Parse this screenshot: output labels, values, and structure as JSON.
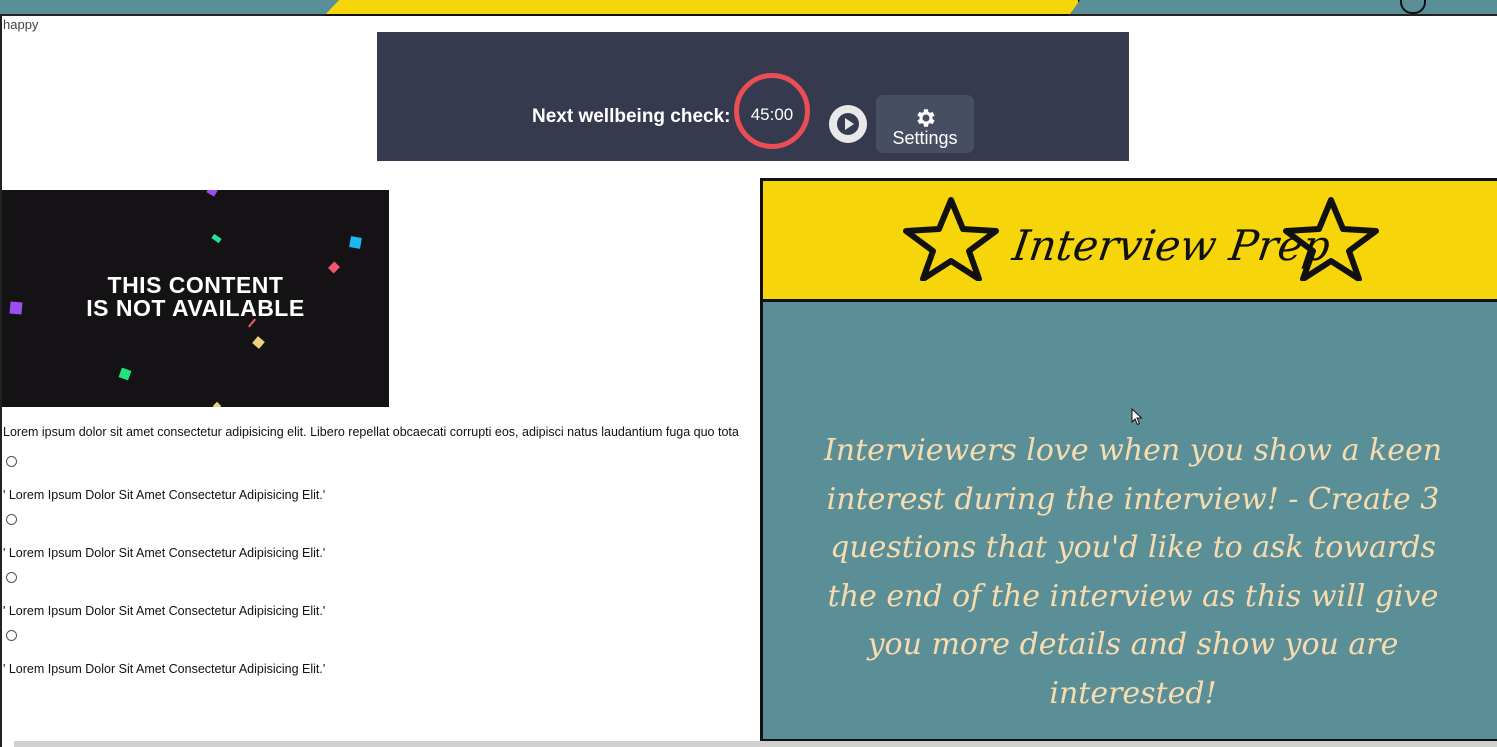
{
  "page": {
    "broken_image_alt": "happy"
  },
  "timer": {
    "label": "Next wellbeing check:",
    "value": "45:00",
    "settings_label": "Settings"
  },
  "video": {
    "line1": "THIS CONTENT",
    "line2": "IS NOT AVAILABLE"
  },
  "content": {
    "lorem": "Lorem ipsum dolor sit amet consectetur adipisicing elit. Libero repellat obcaecati corrupti eos, adipisci natus laudantium fuga quo tota",
    "options": [
      "' Lorem Ipsum Dolor Sit Amet Consectetur Adipisicing Elit.'",
      "' Lorem Ipsum Dolor Sit Amet Consectetur Adipisicing Elit.'",
      "' Lorem Ipsum Dolor Sit Amet Consectetur Adipisicing Elit.'",
      "' Lorem Ipsum Dolor Sit Amet Consectetur Adipisicing Elit.'"
    ]
  },
  "prep": {
    "title": "Interview Prep",
    "body": "Interviewers love when you show a keen interest during the interview! - Create 3 questions that you'd like to ask towards the end of the interview as this will give you more details and show you are interested!"
  },
  "colors": {
    "teal": "#5b8f98",
    "yellow": "#f6d60b",
    "timer_bg": "#353a4e",
    "timer_ring": "#ec4d55",
    "body_text": "#f9dcae"
  },
  "icons": [
    "play-icon",
    "gear-icon",
    "star-icon",
    "cursor-icon"
  ]
}
